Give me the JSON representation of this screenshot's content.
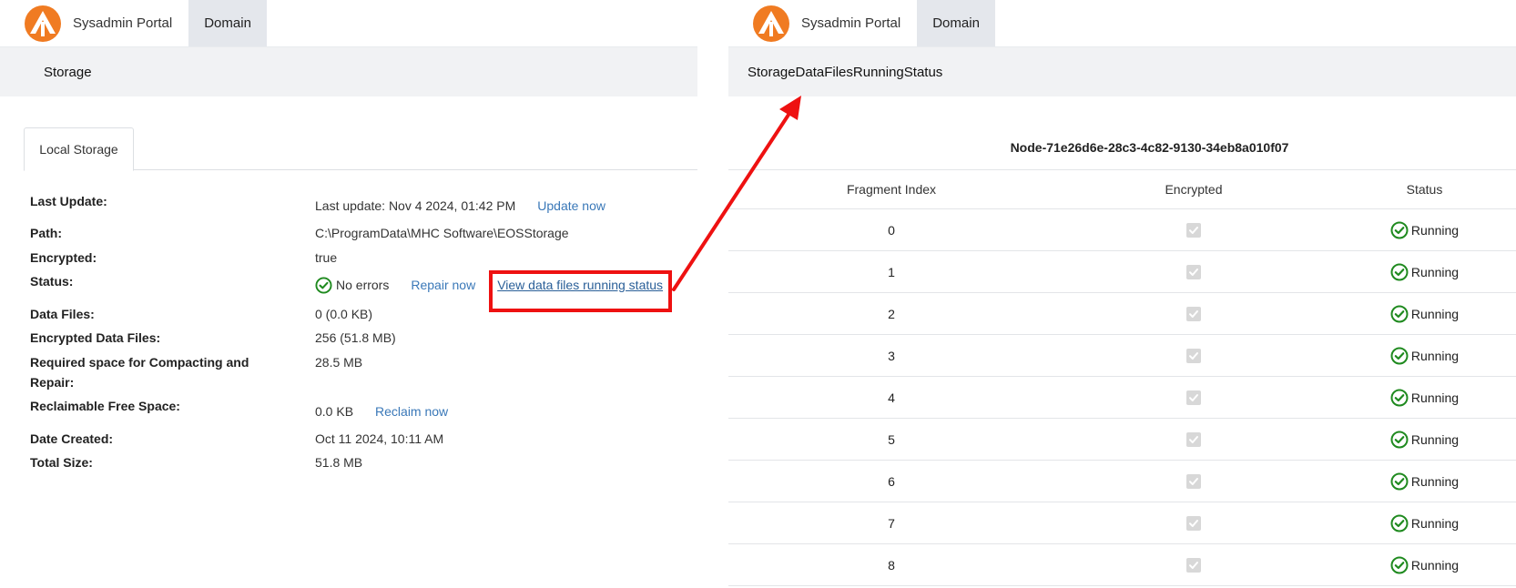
{
  "left": {
    "topbar": {
      "brand": "Sysadmin Portal",
      "nav_tab": "Domain"
    },
    "breadcrumb": "Storage",
    "tab": "Local Storage",
    "fields": {
      "last_update_label": "Last Update:",
      "last_update_value": "Last update: Nov 4 2024, 01:42 PM",
      "update_now": "Update now",
      "path_label": "Path:",
      "path_value": "C:\\ProgramData\\MHC Software\\EOSStorage",
      "encrypted_label": "Encrypted:",
      "encrypted_value": "true",
      "status_label": "Status:",
      "status_value": "No errors",
      "repair_now": "Repair now",
      "view_running_status": "View data files running status",
      "data_files_label": "Data Files:",
      "data_files_value": "0 (0.0 KB)",
      "enc_data_files_label": "Encrypted Data Files:",
      "enc_data_files_value": "256 (51.8 MB)",
      "required_space_label": "Required space for Compacting and Repair:",
      "required_space_value": "28.5 MB",
      "reclaimable_label": "Reclaimable Free Space:",
      "reclaimable_value": "0.0 KB",
      "reclaim_now": "Reclaim now",
      "date_created_label": "Date Created:",
      "date_created_value": "Oct 11 2024, 10:11 AM",
      "total_size_label": "Total Size:",
      "total_size_value": "51.8 MB"
    }
  },
  "right": {
    "topbar": {
      "brand": "Sysadmin Portal",
      "nav_tab": "Domain"
    },
    "breadcrumb": "StorageDataFilesRunningStatus",
    "node_title": "Node-71e26d6e-28c3-4c82-9130-34eb8a010f07",
    "columns": [
      "Fragment Index",
      "Encrypted",
      "Status"
    ],
    "rows": [
      {
        "index": "0",
        "encrypted": true,
        "status": "Running"
      },
      {
        "index": "1",
        "encrypted": true,
        "status": "Running"
      },
      {
        "index": "2",
        "encrypted": true,
        "status": "Running"
      },
      {
        "index": "3",
        "encrypted": true,
        "status": "Running"
      },
      {
        "index": "4",
        "encrypted": true,
        "status": "Running"
      },
      {
        "index": "5",
        "encrypted": true,
        "status": "Running"
      },
      {
        "index": "6",
        "encrypted": true,
        "status": "Running"
      },
      {
        "index": "7",
        "encrypted": true,
        "status": "Running"
      },
      {
        "index": "8",
        "encrypted": true,
        "status": "Running"
      }
    ]
  },
  "icons": {
    "logo": "orange-arrow-logo-icon",
    "status_ok": "check-circle-icon",
    "checkbox": "checked-checkbox-icon"
  },
  "colors": {
    "accent_orange": "#f07b22",
    "link_blue": "#3a78b8",
    "ok_green": "#1f8a1f",
    "highlight_red": "#ee1111",
    "tab_gray": "#e4e7ec",
    "subbar_gray": "#f1f2f4"
  }
}
